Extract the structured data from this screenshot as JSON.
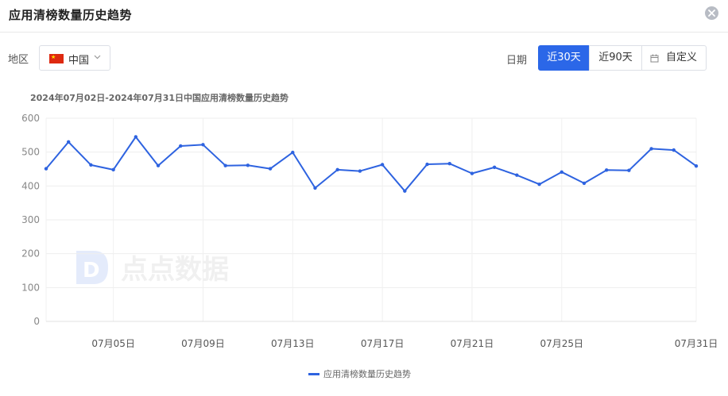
{
  "header": {
    "title": "应用清榜数量历史趋势"
  },
  "filters": {
    "region_label": "地区",
    "region_value": "中国",
    "date_label": "日期",
    "ranges": [
      "近30天",
      "近90天",
      "自定义"
    ]
  },
  "watermark": "点点数据",
  "chart_data": {
    "type": "line",
    "title": "2024年07月02日-2024年07月31日中国应用清榜数量历史趋势",
    "ylim": [
      0,
      600
    ],
    "y_ticks": [
      "600",
      "500",
      "400",
      "300",
      "200",
      "100",
      "0"
    ],
    "x_ticks": [
      "07月05日",
      "07月09日",
      "07月13日",
      "07月17日",
      "07月21日",
      "07月25日",
      "07月31日"
    ],
    "x": [
      "07月02日",
      "07月03日",
      "07月04日",
      "07月05日",
      "07月06日",
      "07月07日",
      "07月08日",
      "07月09日",
      "07月10日",
      "07月11日",
      "07月12日",
      "07月13日",
      "07月14日",
      "07月15日",
      "07月16日",
      "07月17日",
      "07月18日",
      "07月19日",
      "07月20日",
      "07月21日",
      "07月22日",
      "07月23日",
      "07月24日",
      "07月25日",
      "07月26日",
      "07月27日",
      "07月28日",
      "07月29日",
      "07月30日",
      "07月31日"
    ],
    "series": [
      {
        "name": "应用清榜数量历史趋势",
        "color": "#2e63e0",
        "values": [
          451,
          530,
          462,
          448,
          545,
          460,
          518,
          522,
          460,
          461,
          451,
          499,
          394,
          448,
          444,
          463,
          385,
          464,
          466,
          437,
          455,
          432,
          405,
          441,
          408,
          447,
          446,
          510,
          506,
          459
        ]
      }
    ],
    "grid": true,
    "legend": "bottom-center"
  }
}
